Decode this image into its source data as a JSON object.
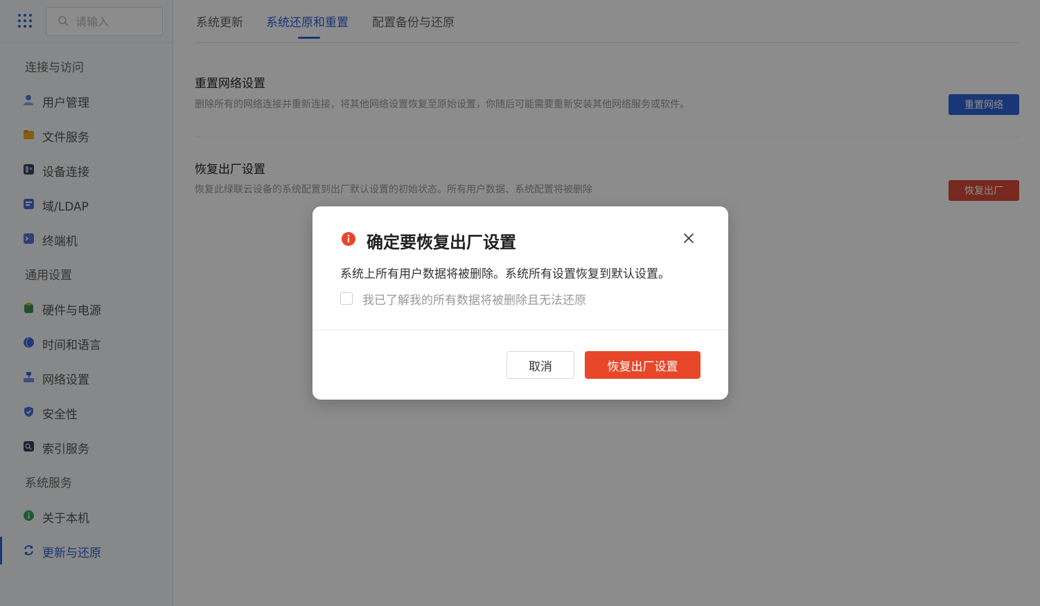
{
  "colors": {
    "accent": "#2f63d8",
    "danger": "#e8472a",
    "reset_network_button": "#2f63d8",
    "factory_button": "#d9493a"
  },
  "sidebar": {
    "search_placeholder": "请输入",
    "groups": [
      {
        "label": "连接与访问"
      },
      {
        "label": "通用设置"
      },
      {
        "label": "系统服务"
      }
    ],
    "items": [
      {
        "label": "用户管理",
        "icon": "users-icon"
      },
      {
        "label": "文件服务",
        "icon": "folder-icon"
      },
      {
        "label": "设备连接",
        "icon": "device-icon"
      },
      {
        "label": "域/LDAP",
        "icon": "domain-icon"
      },
      {
        "label": "终端机",
        "icon": "terminal-icon"
      },
      {
        "label": "硬件与电源",
        "icon": "hardware-icon"
      },
      {
        "label": "时间和语言",
        "icon": "globe-icon"
      },
      {
        "label": "网络设置",
        "icon": "network-icon"
      },
      {
        "label": "安全性",
        "icon": "shield-icon"
      },
      {
        "label": "索引服务",
        "icon": "index-icon"
      },
      {
        "label": "关于本机",
        "icon": "info-icon"
      },
      {
        "label": "更新与还原",
        "icon": "refresh-icon",
        "active": true
      }
    ]
  },
  "tabs": [
    {
      "label": "系统更新"
    },
    {
      "label": "系统还原和重置",
      "active": true
    },
    {
      "label": "配置备份与还原"
    }
  ],
  "sections": {
    "reset_network": {
      "title": "重置网络设置",
      "desc": "删除所有的网络连接并重新连接，将其他网络设置恢复至原始设置，你随后可能需要重新安装其他网络服务或软件。",
      "button": "重置网络"
    },
    "factory_reset": {
      "title": "恢复出厂设置",
      "desc": "恢复此绿联云设备的系统配置到出厂默认设置的初始状态。所有用户数据、系统配置将被删除",
      "button": "恢复出厂"
    }
  },
  "modal": {
    "title": "确定要恢复出厂设置",
    "body": "系统上所有用户数据将被删除。系统所有设置恢复到默认设置。",
    "checkbox_label": "我已了解我的所有数据将被删除且无法还原",
    "checkbox_checked": false,
    "cancel": "取消",
    "confirm": "恢复出厂设置"
  }
}
